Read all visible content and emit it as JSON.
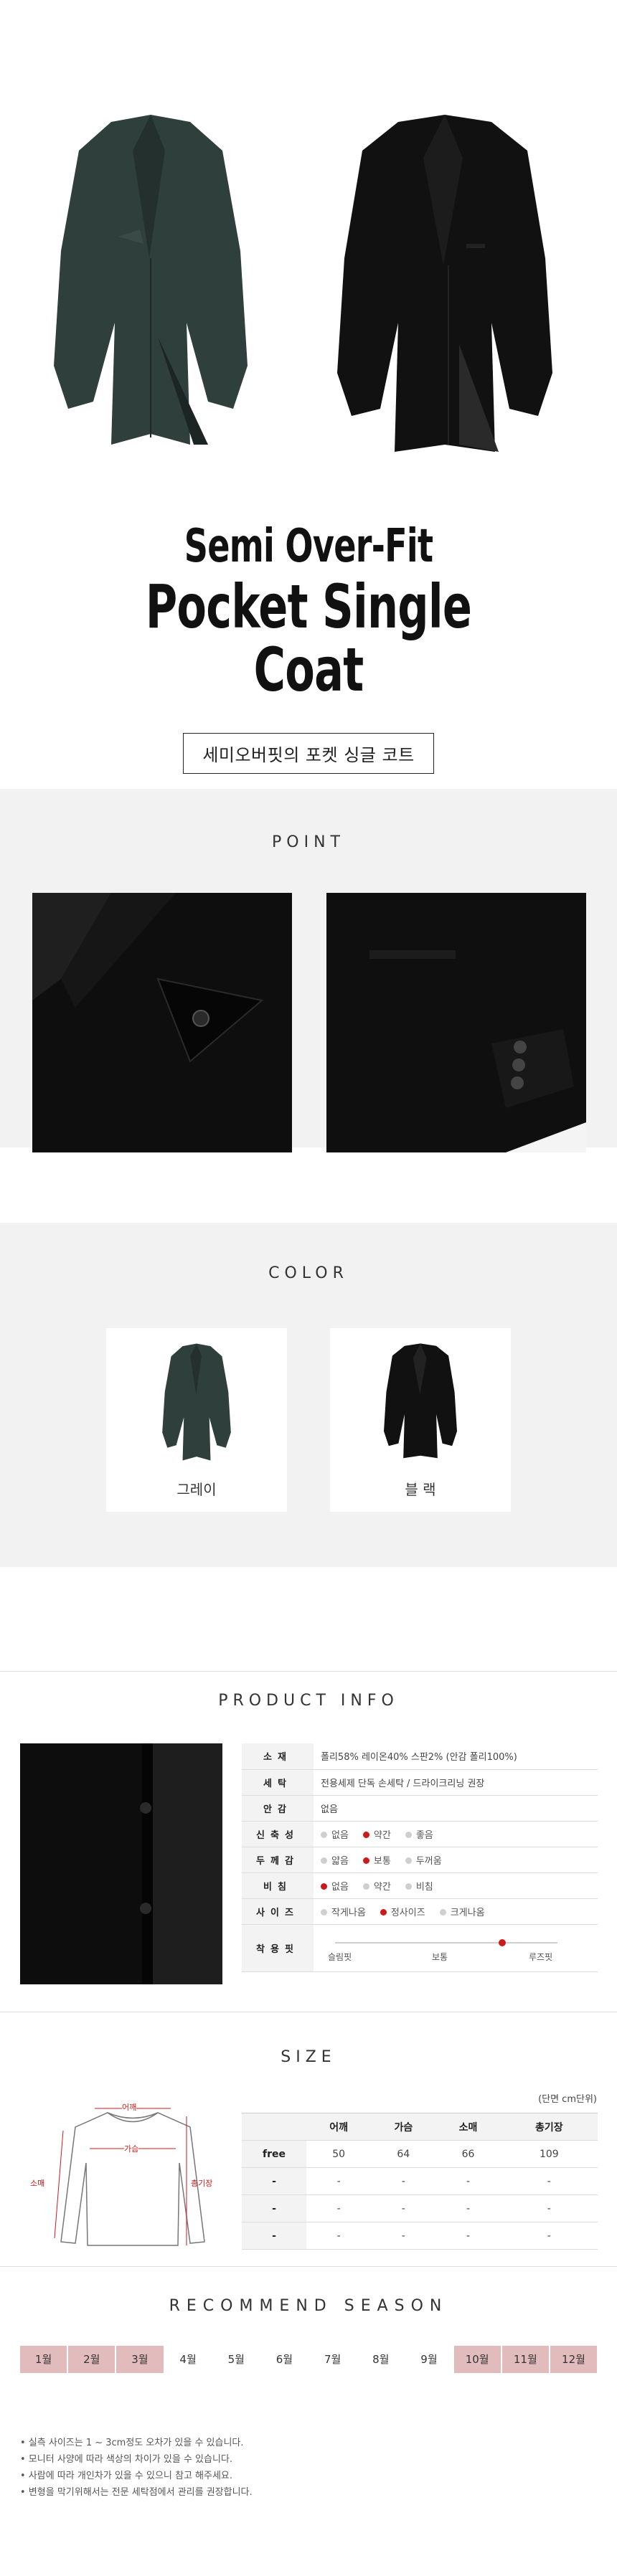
{
  "hero": {
    "title_line1": "Semi Over-Fit",
    "title_line2": "Pocket Single Coat",
    "korean_title": "세미오버핏의 포켓 싱글 코트"
  },
  "point": {
    "heading": "POINT"
  },
  "color": {
    "heading": "COLOR",
    "swatches": [
      {
        "label": "그레이",
        "color": "#2e3d3a"
      },
      {
        "label": "블  랙",
        "color": "#111111"
      }
    ]
  },
  "info": {
    "heading": "PRODUCT INFO",
    "rows": [
      {
        "key": "소재",
        "value": "폴리58%  레이온40% 스판2% (안감 폴리100%)"
      },
      {
        "key": "세탁",
        "value": "전용세제 단독 손세탁 / 드라이크리닝 권장"
      },
      {
        "key": "안감",
        "value": "없음"
      }
    ],
    "option_rows": [
      {
        "key": "신축성",
        "options": [
          "없음",
          "약간",
          "좋음"
        ],
        "selected": 1
      },
      {
        "key": "두께감",
        "options": [
          "얇음",
          "보통",
          "두꺼움"
        ],
        "selected": 1
      },
      {
        "key": "비침",
        "options": [
          "없음",
          "약간",
          "비침"
        ],
        "selected": 0
      },
      {
        "key": "사이즈",
        "options": [
          "작게나옴",
          "정사이즈",
          "크게나옴"
        ],
        "selected": 1
      }
    ],
    "fit": {
      "key": "착용핏",
      "labels": [
        "슬림핏",
        "보통",
        "루즈핏"
      ],
      "value": 0.75
    }
  },
  "size": {
    "heading": "SIZE",
    "unit": "(단면 cm단위)",
    "diagram_labels": {
      "shoulder": "어깨",
      "chest": "가슴",
      "sleeve": "소매",
      "length": "총기장"
    },
    "headers": [
      "",
      "어깨",
      "가슴",
      "소매",
      "총기장"
    ],
    "rows": [
      [
        "free",
        "50",
        "64",
        "66",
        "109"
      ],
      [
        "-",
        "-",
        "-",
        "-",
        "-"
      ],
      [
        "-",
        "-",
        "-",
        "-",
        "-"
      ],
      [
        "-",
        "-",
        "-",
        "-",
        "-"
      ]
    ]
  },
  "season": {
    "heading": "RECOMMEND SEASON",
    "months": [
      "1월",
      "2월",
      "3월",
      "4월",
      "5월",
      "6월",
      "7월",
      "8월",
      "9월",
      "10월",
      "11월",
      "12월"
    ],
    "active": [
      1,
      1,
      1,
      0,
      0,
      0,
      0,
      0,
      0,
      1,
      1,
      1
    ],
    "active_color": "#e2bcbd"
  },
  "notes": [
    "• 실측 사이즈는 1 ~ 3cm정도 오차가 있을 수 있습니다.",
    "• 모니터 사양에 따라 색상의 차이가 있을 수 있습니다.",
    "• 사람에 따라 개인차가 있을 수 있으니 참고 해주세요.",
    "• 변형을 막기위해서는 전문 세탁점에서 관리를 권장합니다."
  ]
}
